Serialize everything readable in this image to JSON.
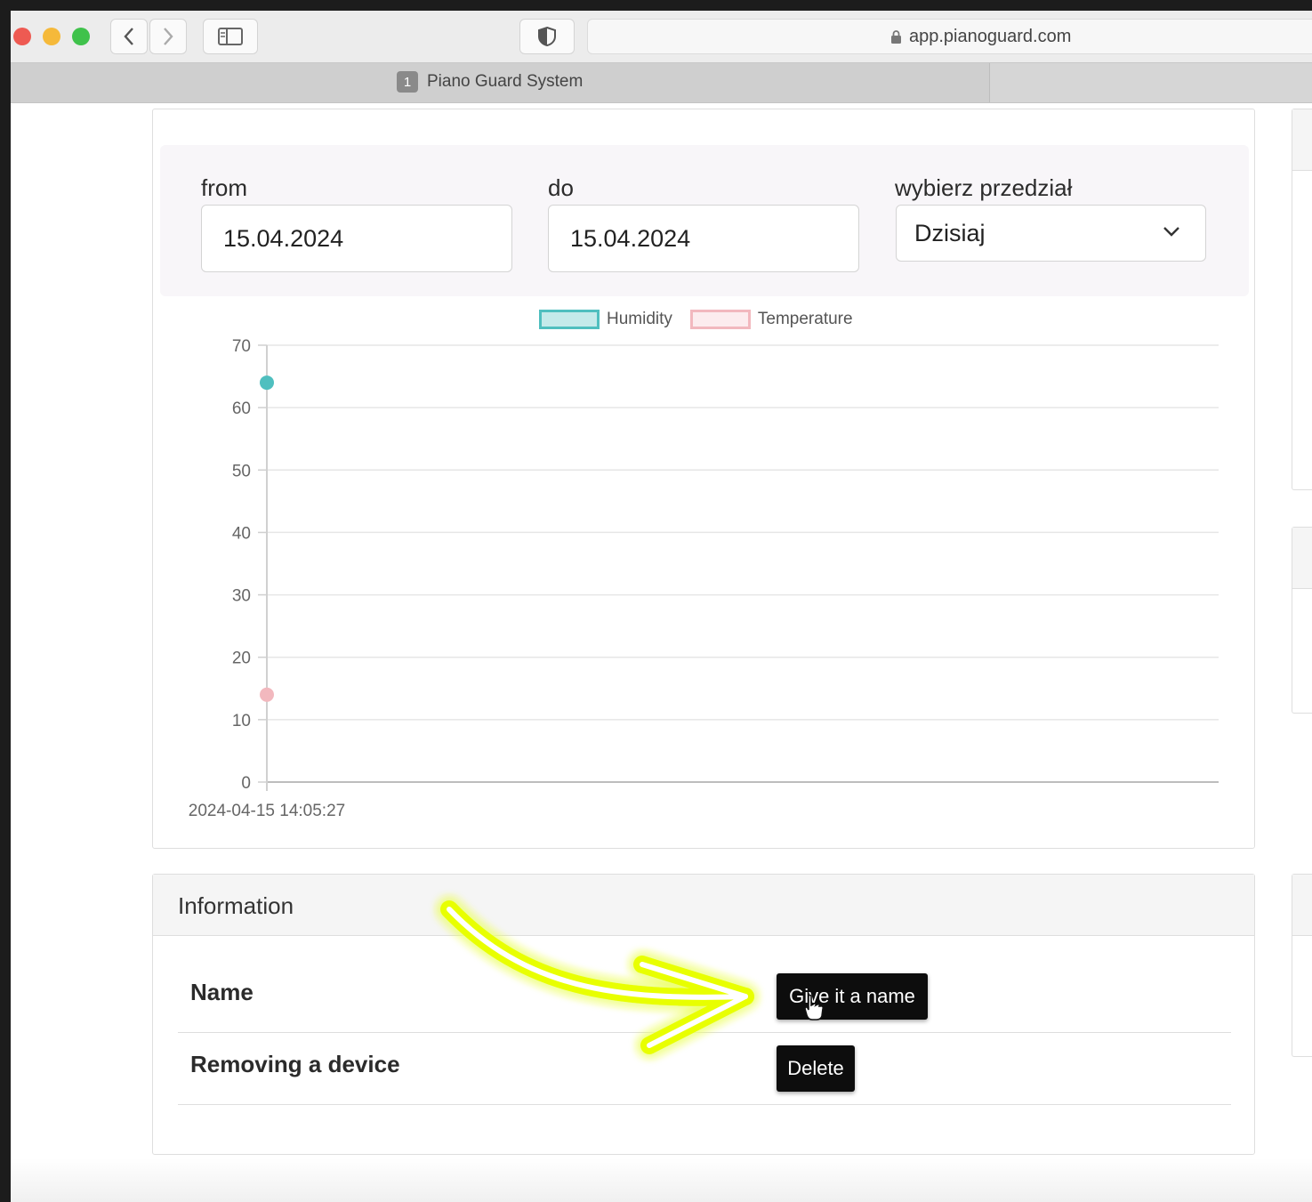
{
  "browser": {
    "url": "app.pianoguard.com",
    "tab": {
      "number": "1",
      "title": "Piano Guard System"
    }
  },
  "filters": {
    "from_label": "from",
    "from_value": "15.04.2024",
    "to_label": "do",
    "to_value": "15.04.2024",
    "range_label": "wybierz przedział",
    "range_value": "Dzisiaj"
  },
  "chart_data": {
    "type": "line",
    "x": [
      "2024-04-15 14:05:27"
    ],
    "series": [
      {
        "name": "Humidity",
        "values": [
          64
        ],
        "color": "#4fbfbf"
      },
      {
        "name": "Temperature",
        "values": [
          14
        ],
        "color": "#f2b8be"
      }
    ],
    "ylim": [
      0,
      70
    ],
    "yticks": [
      0,
      10,
      20,
      30,
      40,
      50,
      60,
      70
    ],
    "grid": true,
    "legend": "top-center"
  },
  "information": {
    "title": "Information",
    "rows": [
      {
        "label": "Name",
        "button": "Give it a name"
      },
      {
        "label": "Removing a device",
        "button": "Delete"
      }
    ]
  },
  "annotation": {
    "arrow_color": "#e8ff00"
  }
}
